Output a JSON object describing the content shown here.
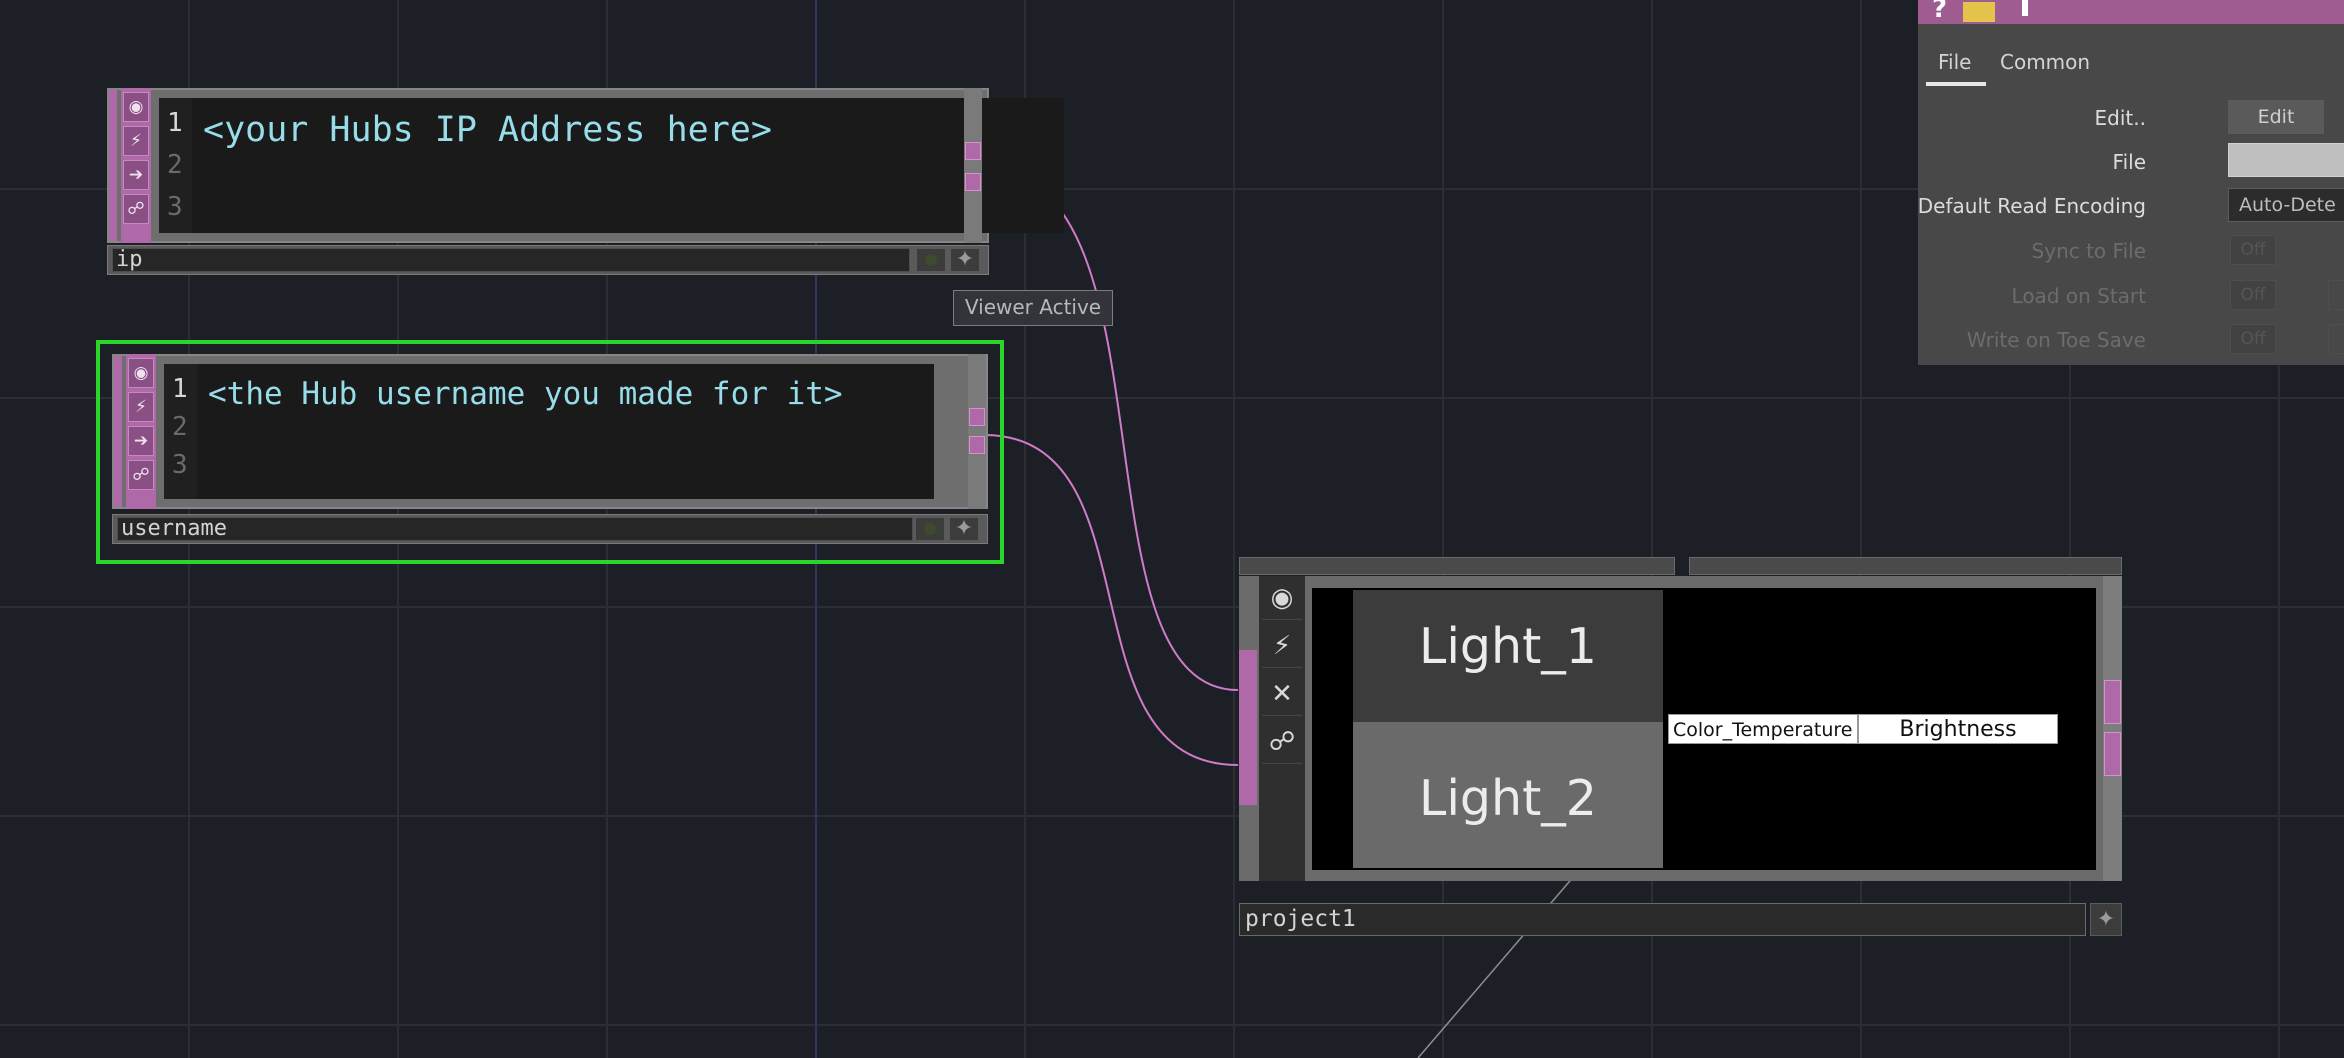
{
  "nodes": [
    {
      "id": "ip",
      "name": "ip",
      "lines": [
        "1",
        "2",
        "3"
      ],
      "text": "<your Hubs IP Address here>",
      "selected": false
    },
    {
      "id": "username",
      "name": "username",
      "lines": [
        "1",
        "2",
        "3"
      ],
      "text": "<the Hub username you made for it>",
      "selected": true
    }
  ],
  "node_icons": [
    "viewer-icon",
    "pulse-icon",
    "arrow-right-icon",
    "clone-icon"
  ],
  "tooltip": "Viewer Active",
  "project": {
    "name": "project1",
    "lights": [
      "Light_1",
      "Light_2"
    ],
    "columns": [
      "Color_Temperature",
      "Brightness"
    ],
    "icons": [
      "viewer-icon",
      "pulse-icon",
      "close-icon",
      "clone-icon"
    ]
  },
  "params": {
    "toolbar_icons": [
      "help-icon",
      "folder-icon",
      "info-icon"
    ],
    "tabs": [
      "File",
      "Common"
    ],
    "active_tab": "File",
    "rows": [
      {
        "label": "Edit..",
        "kind": "button",
        "value": "Edit",
        "enabled": true
      },
      {
        "label": "File",
        "kind": "field",
        "value": "",
        "enabled": true
      },
      {
        "label": "Default Read Encoding",
        "kind": "menu",
        "value": "Auto-Dete",
        "enabled": true
      },
      {
        "label": "Sync to File",
        "kind": "toggle",
        "value": "Off",
        "enabled": false
      },
      {
        "label": "Load on Start",
        "kind": "toggle",
        "value": "Off",
        "enabled": false
      },
      {
        "label": "Write on Toe Save",
        "kind": "toggle",
        "value": "Off",
        "enabled": false
      }
    ]
  },
  "colors": {
    "background": "#1d1f26",
    "grid": "#2c2e36",
    "operator_pink": "#b069a8",
    "wire": "#d07bc8",
    "selection": "#2ad62a",
    "code_text": "#97dde9",
    "panel_title": "#9f5c90"
  }
}
